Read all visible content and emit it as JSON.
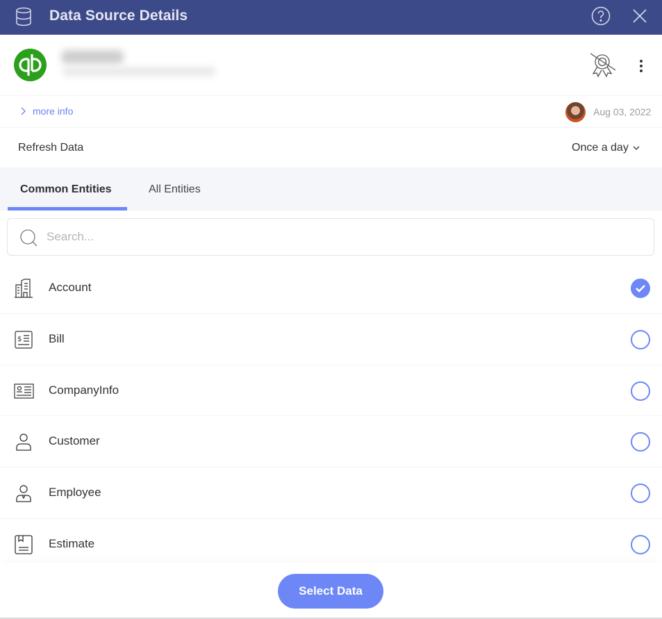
{
  "header": {
    "title": "Data Source Details",
    "icons": {
      "left": "database-icon",
      "help": "help-circle-icon",
      "close": "close-icon"
    }
  },
  "source": {
    "logo": "quickbooks-logo",
    "name": "[redacted]",
    "subtitle": "[redacted]",
    "actions": {
      "certify": "certification-off-icon",
      "more": "more-vertical-icon"
    }
  },
  "info": {
    "more_info_label": "more info",
    "modified_date": "Aug 03, 2022",
    "avatar": "user-avatar"
  },
  "refresh": {
    "label": "Refresh Data",
    "frequency": "Once a day"
  },
  "tabs": [
    {
      "label": "Common Entities",
      "active": true
    },
    {
      "label": "All Entities",
      "active": false
    }
  ],
  "search": {
    "placeholder": "Search...",
    "value": ""
  },
  "entities": [
    {
      "label": "Account",
      "icon": "building-icon",
      "selected": true
    },
    {
      "label": "Bill",
      "icon": "bill-icon",
      "selected": false
    },
    {
      "label": "CompanyInfo",
      "icon": "id-card-icon",
      "selected": false
    },
    {
      "label": "Customer",
      "icon": "person-icon",
      "selected": false
    },
    {
      "label": "Employee",
      "icon": "employee-icon",
      "selected": false
    },
    {
      "label": "Estimate",
      "icon": "estimate-icon",
      "selected": false
    }
  ],
  "footer": {
    "select_label": "Select Data"
  },
  "colors": {
    "header_bg": "#3d4a89",
    "accent": "#6e87f6",
    "quickbooks_green": "#2ca01c"
  }
}
